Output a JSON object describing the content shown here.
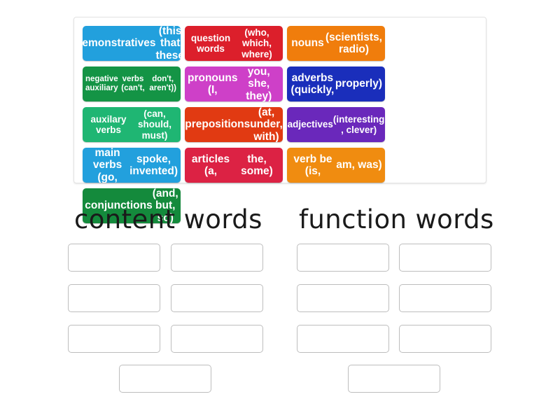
{
  "activity": {
    "type": "group-sort",
    "tray_label": "word-class tiles"
  },
  "tiles": [
    {
      "id": "demonstratives",
      "label": "demonstratives (this, that, these)",
      "line1": "demonstratives",
      "line2": "(this, that, these)",
      "color": "#22a0dd",
      "size": "fs16"
    },
    {
      "id": "question-words",
      "label": "question words (who, which, where)",
      "line1": "question words",
      "line2": "(who, which, where)",
      "color": "#dc1f2b",
      "size": "fs14"
    },
    {
      "id": "nouns",
      "label": "nouns (scientists, radio)",
      "line1": "nouns",
      "line2": "(scientists, radio)",
      "color": "#f07d0c",
      "size": "fs16"
    },
    {
      "id": "negative-auxiliary-verbs",
      "label": "negative auxiliary verbs (can't, don't, aren't))",
      "line1": "negative auxiliary",
      "line2": "verbs (can't,",
      "line3": "don't, aren't))",
      "color": "#149445",
      "size": "fs12"
    },
    {
      "id": "pronouns",
      "label": "pronouns (I, you, she, they)",
      "line1": "pronouns (I,",
      "line2": "you, she, they)",
      "color": "#ce40c8",
      "size": "fs16"
    },
    {
      "id": "adverbs",
      "label": "adverbs (quickly, properly)",
      "line1": "adverbs (quickly,",
      "line2": "properly)",
      "color": "#1a2ebb",
      "size": "fs16"
    },
    {
      "id": "auxilary-verbs",
      "label": "auxilary verbs (can, should, must)",
      "line1": "auxilary verbs",
      "line2": "(can, should, must)",
      "color": "#1fb673",
      "size": "fs14"
    },
    {
      "id": "prepositions",
      "label": "prepositions (at, under, with)",
      "line1": "prepositions",
      "line2": "(at, under, with)",
      "color": "#e13a12",
      "size": "fs16"
    },
    {
      "id": "adjectives",
      "label": "adjectives (interesting , clever)",
      "line1": "adjectives",
      "line2": "(interesting , clever)",
      "color": "#6a28bb",
      "size": "fs14"
    },
    {
      "id": "main-verbs",
      "label": "main verbs (go, spoke, invented)",
      "line1": "main verbs (go,",
      "line2": "spoke, invented)",
      "color": "#22a0dd",
      "size": "fs16"
    },
    {
      "id": "articles",
      "label": "articles (a, the, some)",
      "line1": "articles (a,",
      "line2": "the, some)",
      "color": "#dc2244",
      "size": "fs16"
    },
    {
      "id": "verb-be",
      "label": "verb be (is, am, was)",
      "line1": "verb be (is,",
      "line2": "am, was)",
      "color": "#f08c10",
      "size": "fs16"
    },
    {
      "id": "conjunctions",
      "label": "conjunctions (and, but, so)",
      "line1": "conjunctions",
      "line2": "(and, but, so)",
      "color": "#148a3c",
      "size": "fs16"
    }
  ],
  "categories": [
    {
      "id": "content-words",
      "title": "content words",
      "slots": [
        "",
        "",
        "",
        "",
        "",
        "",
        ""
      ]
    },
    {
      "id": "function-words",
      "title": "function words",
      "slots": [
        "",
        "",
        "",
        "",
        "",
        "",
        ""
      ]
    }
  ],
  "colors": {
    "tray_border": "#e3e3e3",
    "slot_border": "#bdbdbd",
    "page_background": "#ffffff",
    "heading_text": "#1a1a1a"
  }
}
